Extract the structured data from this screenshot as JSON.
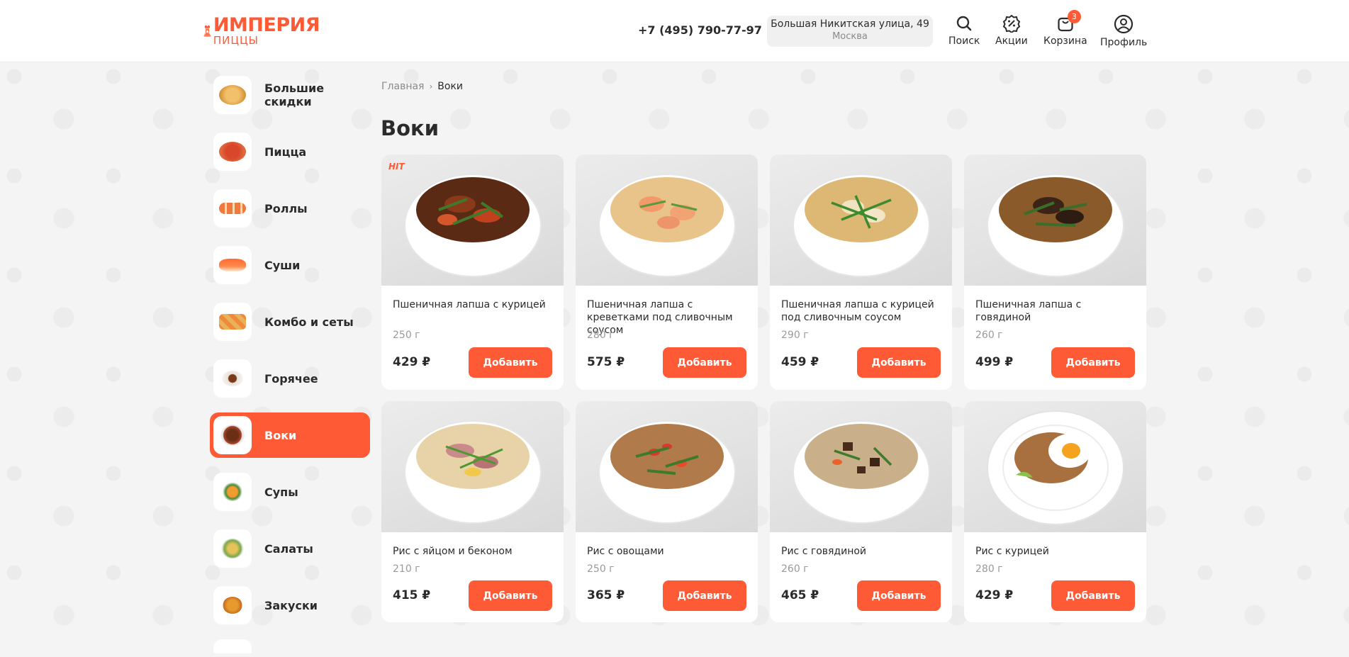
{
  "brand": {
    "name": "ИМПЕРИЯ",
    "subname": "ПИЦЦЫ",
    "accent": "#ff5a36"
  },
  "header": {
    "phone": "+7 (495) 790-77-97",
    "address": {
      "street": "Большая Никитская улица, 49",
      "city": "Москва"
    },
    "nav": {
      "search": "Поиск",
      "promos": "Акции",
      "cart": "Корзина",
      "cart_count": "3",
      "profile": "Профиль"
    }
  },
  "sidebar": {
    "items": [
      {
        "label": "Большие скидки",
        "icon": "pizza-thumb"
      },
      {
        "label": "Пицца",
        "icon": "pizza-thumb"
      },
      {
        "label": "Роллы",
        "icon": "rolls-thumb"
      },
      {
        "label": "Суши",
        "icon": "sushi-thumb"
      },
      {
        "label": "Комбо и сеты",
        "icon": "combo-thumb"
      },
      {
        "label": "Горячее",
        "icon": "hot-dish-thumb"
      },
      {
        "label": "Воки",
        "icon": "wok-thumb",
        "active": true
      },
      {
        "label": "Супы",
        "icon": "soup-thumb"
      },
      {
        "label": "Салаты",
        "icon": "salad-thumb"
      },
      {
        "label": "Закуски",
        "icon": "snacks-thumb"
      }
    ]
  },
  "breadcrumb": {
    "home": "Главная",
    "current": "Воки"
  },
  "page_title": "Воки",
  "products": [
    {
      "name": "Пшеничная лапша с курицей",
      "weight": "250 г",
      "price": "429 ₽",
      "button": "Добавить",
      "badge": "HIT"
    },
    {
      "name": "Пшеничная лапша с креветками под сливочным соусом",
      "weight": "280 г",
      "price": "575 ₽",
      "button": "Добавить"
    },
    {
      "name": "Пшеничная лапша с курицей под сливочным соусом",
      "weight": "290 г",
      "price": "459 ₽",
      "button": "Добавить"
    },
    {
      "name": "Пшеничная лапша с говядиной",
      "weight": "260 г",
      "price": "499 ₽",
      "button": "Добавить"
    },
    {
      "name": "Рис с яйцом и беконом",
      "weight": "210 г",
      "price": "415 ₽",
      "button": "Добавить"
    },
    {
      "name": "Рис с овощами",
      "weight": "250 г",
      "price": "365 ₽",
      "button": "Добавить"
    },
    {
      "name": "Рис с говядиной",
      "weight": "260 г",
      "price": "465 ₽",
      "button": "Добавить"
    },
    {
      "name": "Рис с курицей",
      "weight": "280 г",
      "price": "429 ₽",
      "button": "Добавить"
    }
  ]
}
